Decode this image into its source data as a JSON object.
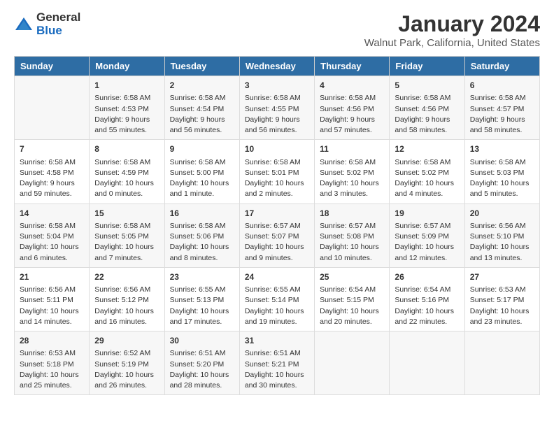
{
  "logo": {
    "general": "General",
    "blue": "Blue"
  },
  "header": {
    "title": "January 2024",
    "subtitle": "Walnut Park, California, United States"
  },
  "weekdays": [
    "Sunday",
    "Monday",
    "Tuesday",
    "Wednesday",
    "Thursday",
    "Friday",
    "Saturday"
  ],
  "weeks": [
    [
      {
        "day": "",
        "content": ""
      },
      {
        "day": "1",
        "content": "Sunrise: 6:58 AM\nSunset: 4:53 PM\nDaylight: 9 hours\nand 55 minutes."
      },
      {
        "day": "2",
        "content": "Sunrise: 6:58 AM\nSunset: 4:54 PM\nDaylight: 9 hours\nand 56 minutes."
      },
      {
        "day": "3",
        "content": "Sunrise: 6:58 AM\nSunset: 4:55 PM\nDaylight: 9 hours\nand 56 minutes."
      },
      {
        "day": "4",
        "content": "Sunrise: 6:58 AM\nSunset: 4:56 PM\nDaylight: 9 hours\nand 57 minutes."
      },
      {
        "day": "5",
        "content": "Sunrise: 6:58 AM\nSunset: 4:56 PM\nDaylight: 9 hours\nand 58 minutes."
      },
      {
        "day": "6",
        "content": "Sunrise: 6:58 AM\nSunset: 4:57 PM\nDaylight: 9 hours\nand 58 minutes."
      }
    ],
    [
      {
        "day": "7",
        "content": "Sunrise: 6:58 AM\nSunset: 4:58 PM\nDaylight: 9 hours\nand 59 minutes."
      },
      {
        "day": "8",
        "content": "Sunrise: 6:58 AM\nSunset: 4:59 PM\nDaylight: 10 hours\nand 0 minutes."
      },
      {
        "day": "9",
        "content": "Sunrise: 6:58 AM\nSunset: 5:00 PM\nDaylight: 10 hours\nand 1 minute."
      },
      {
        "day": "10",
        "content": "Sunrise: 6:58 AM\nSunset: 5:01 PM\nDaylight: 10 hours\nand 2 minutes."
      },
      {
        "day": "11",
        "content": "Sunrise: 6:58 AM\nSunset: 5:02 PM\nDaylight: 10 hours\nand 3 minutes."
      },
      {
        "day": "12",
        "content": "Sunrise: 6:58 AM\nSunset: 5:02 PM\nDaylight: 10 hours\nand 4 minutes."
      },
      {
        "day": "13",
        "content": "Sunrise: 6:58 AM\nSunset: 5:03 PM\nDaylight: 10 hours\nand 5 minutes."
      }
    ],
    [
      {
        "day": "14",
        "content": "Sunrise: 6:58 AM\nSunset: 5:04 PM\nDaylight: 10 hours\nand 6 minutes."
      },
      {
        "day": "15",
        "content": "Sunrise: 6:58 AM\nSunset: 5:05 PM\nDaylight: 10 hours\nand 7 minutes."
      },
      {
        "day": "16",
        "content": "Sunrise: 6:58 AM\nSunset: 5:06 PM\nDaylight: 10 hours\nand 8 minutes."
      },
      {
        "day": "17",
        "content": "Sunrise: 6:57 AM\nSunset: 5:07 PM\nDaylight: 10 hours\nand 9 minutes."
      },
      {
        "day": "18",
        "content": "Sunrise: 6:57 AM\nSunset: 5:08 PM\nDaylight: 10 hours\nand 10 minutes."
      },
      {
        "day": "19",
        "content": "Sunrise: 6:57 AM\nSunset: 5:09 PM\nDaylight: 10 hours\nand 12 minutes."
      },
      {
        "day": "20",
        "content": "Sunrise: 6:56 AM\nSunset: 5:10 PM\nDaylight: 10 hours\nand 13 minutes."
      }
    ],
    [
      {
        "day": "21",
        "content": "Sunrise: 6:56 AM\nSunset: 5:11 PM\nDaylight: 10 hours\nand 14 minutes."
      },
      {
        "day": "22",
        "content": "Sunrise: 6:56 AM\nSunset: 5:12 PM\nDaylight: 10 hours\nand 16 minutes."
      },
      {
        "day": "23",
        "content": "Sunrise: 6:55 AM\nSunset: 5:13 PM\nDaylight: 10 hours\nand 17 minutes."
      },
      {
        "day": "24",
        "content": "Sunrise: 6:55 AM\nSunset: 5:14 PM\nDaylight: 10 hours\nand 19 minutes."
      },
      {
        "day": "25",
        "content": "Sunrise: 6:54 AM\nSunset: 5:15 PM\nDaylight: 10 hours\nand 20 minutes."
      },
      {
        "day": "26",
        "content": "Sunrise: 6:54 AM\nSunset: 5:16 PM\nDaylight: 10 hours\nand 22 minutes."
      },
      {
        "day": "27",
        "content": "Sunrise: 6:53 AM\nSunset: 5:17 PM\nDaylight: 10 hours\nand 23 minutes."
      }
    ],
    [
      {
        "day": "28",
        "content": "Sunrise: 6:53 AM\nSunset: 5:18 PM\nDaylight: 10 hours\nand 25 minutes."
      },
      {
        "day": "29",
        "content": "Sunrise: 6:52 AM\nSunset: 5:19 PM\nDaylight: 10 hours\nand 26 minutes."
      },
      {
        "day": "30",
        "content": "Sunrise: 6:51 AM\nSunset: 5:20 PM\nDaylight: 10 hours\nand 28 minutes."
      },
      {
        "day": "31",
        "content": "Sunrise: 6:51 AM\nSunset: 5:21 PM\nDaylight: 10 hours\nand 30 minutes."
      },
      {
        "day": "",
        "content": ""
      },
      {
        "day": "",
        "content": ""
      },
      {
        "day": "",
        "content": ""
      }
    ]
  ]
}
